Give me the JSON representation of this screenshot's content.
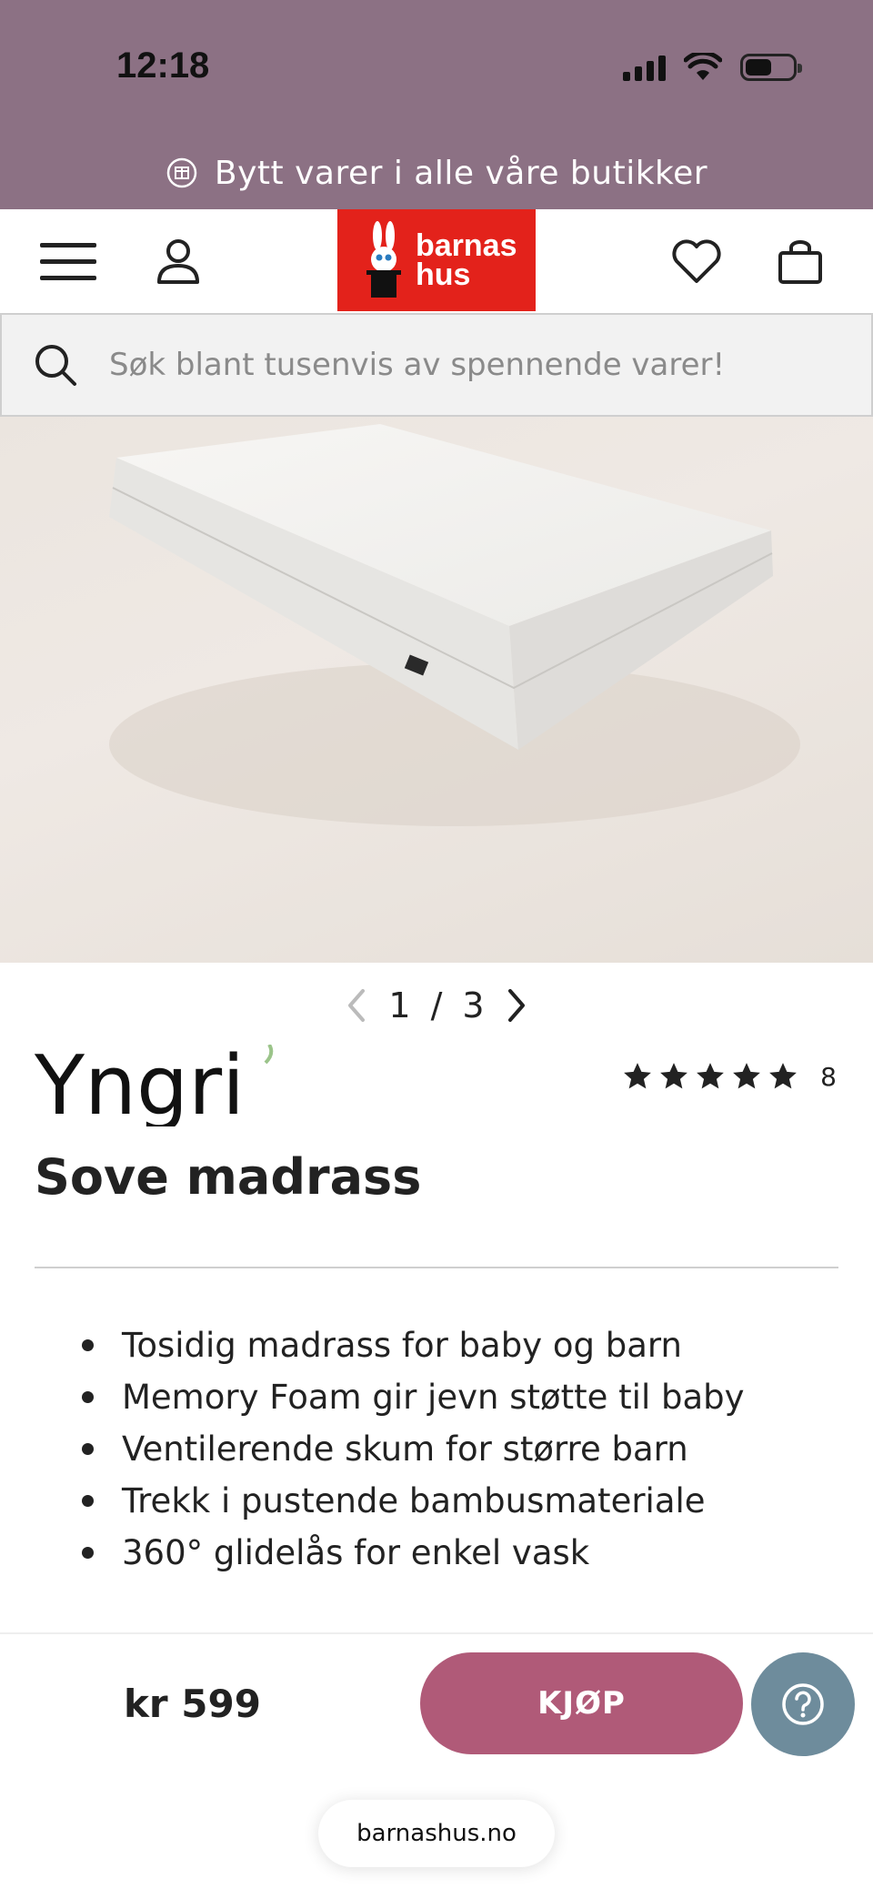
{
  "status_bar": {
    "time": "12:18",
    "icons": [
      "signal-icon",
      "wifi-icon",
      "battery-icon"
    ]
  },
  "promo": {
    "text": "Bytt varer i alle våre butikker",
    "icon": "exchange-icon"
  },
  "header": {
    "icons": [
      "menu-icon",
      "account-icon",
      "heart-icon",
      "cart-icon"
    ],
    "logo_line1": "barnas",
    "logo_line2": "hus",
    "logo_color": "#e3221b"
  },
  "search": {
    "placeholder": "Søk blant tusenvis av spennende varer!"
  },
  "gallery": {
    "current": "1",
    "separator": "/",
    "total": "3"
  },
  "product": {
    "brand": "Yngri",
    "title": "Sove madrass",
    "rating_stars": 5,
    "rating_count": "8",
    "features": [
      "Tosidig madrass for baby og barn",
      "Memory Foam gir jevn støtte til baby",
      "Ventilerende skum for større barn",
      "Trekk i pustende bambusmateriale",
      "360° glidelås for enkel vask"
    ]
  },
  "buybar": {
    "price": "kr 599",
    "buy_label": "KJØP",
    "buy_color": "#b05a78",
    "help_color": "#6e8c9c"
  },
  "browser": {
    "url": "barnashus.no"
  },
  "colors": {
    "top_bar": "#8c7184"
  }
}
